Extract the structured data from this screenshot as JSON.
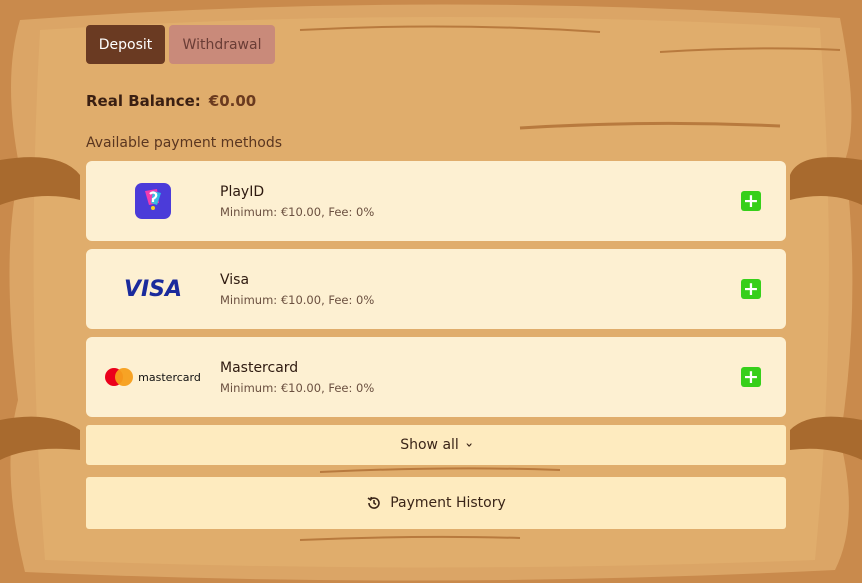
{
  "tabs": {
    "deposit": "Deposit",
    "withdrawal": "Withdrawal"
  },
  "balance": {
    "label": "Real Balance:",
    "amount": "€0.00"
  },
  "methods_heading": "Available payment methods",
  "methods": [
    {
      "name": "PlayID",
      "details": "Minimum: €10.00, Fee: 0%",
      "logo": "playid-logo-icon"
    },
    {
      "name": "Visa",
      "details": "Minimum: €10.00, Fee: 0%",
      "logo_text": "VISA"
    },
    {
      "name": "Mastercard",
      "details": "Minimum: €10.00, Fee: 0%",
      "logo_text": "mastercard"
    }
  ],
  "show_all": "Show all",
  "payment_history": "Payment History",
  "colors": {
    "accent_green": "#36cf1a",
    "tab_active": "#6a3a22",
    "card_bg": "#fdf0d2"
  }
}
